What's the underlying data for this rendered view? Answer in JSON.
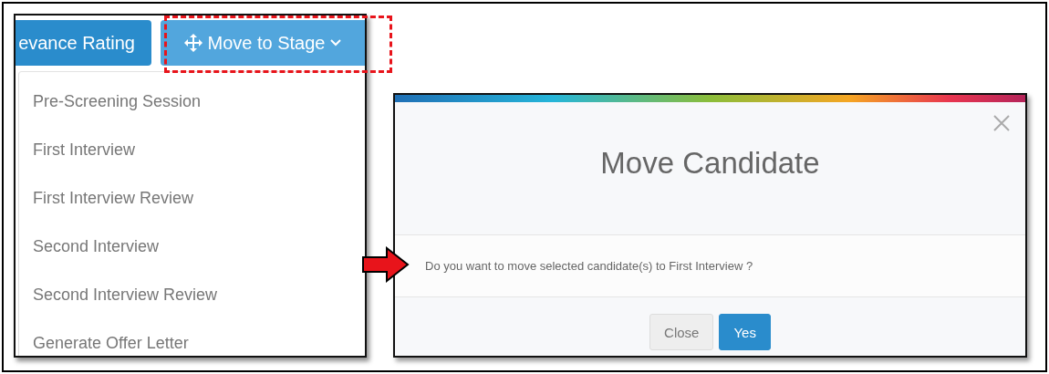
{
  "left_panel": {
    "toolbar": [
      {
        "label": "evance Rating",
        "kind": "button",
        "active": false
      },
      {
        "label": "Move to Stage",
        "kind": "dropdown",
        "active": true
      }
    ],
    "menu": {
      "items": [
        {
          "label": "Pre-Screening Session"
        },
        {
          "label": "First Interview"
        },
        {
          "label": "First Interview Review"
        },
        {
          "label": "Second Interview"
        },
        {
          "label": "Second Interview Review"
        },
        {
          "label": "Generate Offer Letter"
        }
      ]
    }
  },
  "modal": {
    "title": "Move Candidate",
    "message": "Do you want to move selected candidate(s) to First Interview ?",
    "buttons": [
      {
        "label": "Close",
        "kind": "default"
      },
      {
        "label": "Yes",
        "kind": "primary"
      }
    ]
  }
}
